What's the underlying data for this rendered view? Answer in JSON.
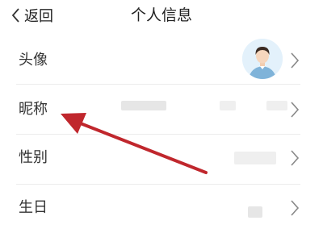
{
  "header": {
    "back_label": "返回",
    "title": "个人信息"
  },
  "rows": [
    {
      "label": "头像"
    },
    {
      "label": "昵称"
    },
    {
      "label": "性别"
    },
    {
      "label": "生日"
    }
  ],
  "colors": {
    "arrow": "#c0272d",
    "divider": "#ececec",
    "avatar_bg": "#e3f1fb",
    "avatar_shirt": "#7fb3d9"
  }
}
